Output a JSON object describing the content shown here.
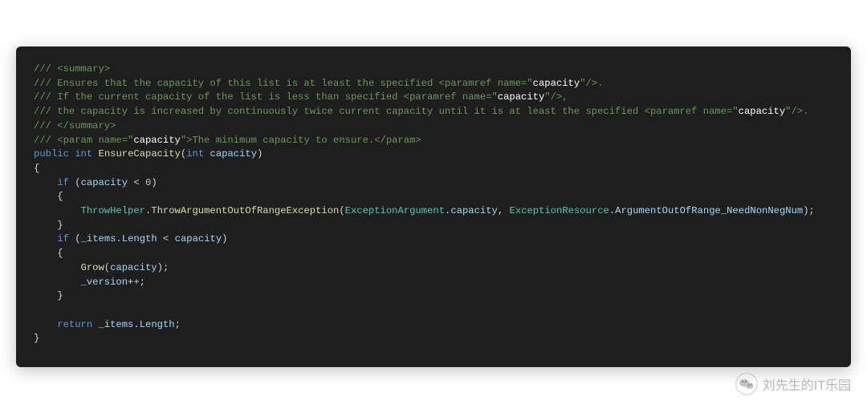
{
  "code": {
    "summary_open": "/// <summary>",
    "summary_line1_a": "/// Ensures that the capacity of this list is at least the specified <paramref name=\"",
    "summary_line1_b": "capacity",
    "summary_line1_c": "\"/>.",
    "summary_line2_a": "/// If the current capacity of the list is less than specified <paramref name=\"",
    "summary_line2_b": "capacity",
    "summary_line2_c": "\"/>,",
    "summary_line3_a": "/// the capacity is increased by continuously twice current capacity until it is at least the specified <paramref name=\"",
    "summary_line3_b": "capacity",
    "summary_line3_c": "\"/>.",
    "summary_close": "/// </summary>",
    "param_open_a": "/// <param name=\"",
    "param_open_b": "capacity",
    "param_open_c": "\">The minimum capacity to ensure.</param>",
    "kw_public": "public",
    "kw_int": "int",
    "method_name": "EnsureCapacity",
    "param_type": "int",
    "param_name": "capacity",
    "brace_open": "{",
    "brace_close": "}",
    "kw_if": "if",
    "cond1_var": "capacity",
    "cond1_op": " < ",
    "cond1_rhs": "0",
    "throw_class": "ThrowHelper",
    "throw_method": "ThrowArgumentOutOfRangeException",
    "exarg_type": "ExceptionArgument",
    "exarg_val": "capacity",
    "exres_type": "ExceptionResource",
    "exres_val": "ArgumentOutOfRange_NeedNonNegNum",
    "cond2_lhs": "_items",
    "cond2_prop": "Length",
    "cond2_op": " < ",
    "cond2_rhs": "capacity",
    "grow_method": "Grow",
    "grow_arg": "capacity",
    "version_field": "_version",
    "kw_return": "return",
    "ret_lhs": "_items",
    "ret_prop": "Length"
  },
  "watermark": {
    "text": "刘先生的IT乐园"
  }
}
